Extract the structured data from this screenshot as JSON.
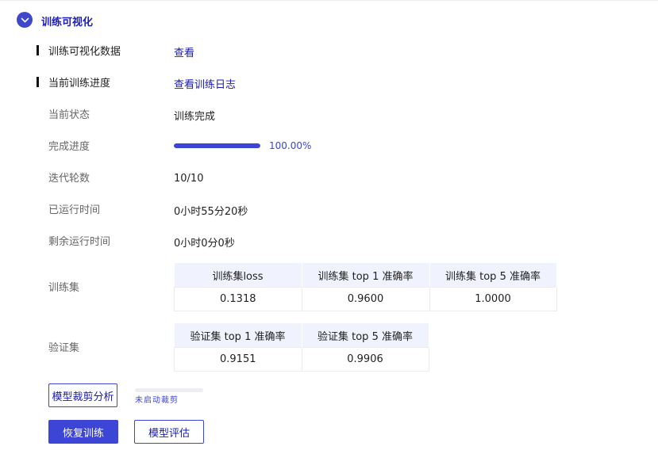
{
  "section": {
    "title": "训练可视化"
  },
  "rows": {
    "viz_data": {
      "label": "训练可视化数据",
      "link": "查看"
    },
    "progress_log": {
      "label": "当前训练进度",
      "link": "查看训练日志"
    },
    "status": {
      "label": "当前状态",
      "value": "训练完成"
    },
    "completion": {
      "label": "完成进度",
      "value_text": "100.00%",
      "fraction": 1.0
    },
    "epochs": {
      "label": "迭代轮数",
      "value": "10/10"
    },
    "elapsed": {
      "label": "已运行时间",
      "value": "0小时55分20秒"
    },
    "remaining": {
      "label": "剩余运行时间",
      "value": "0小时0分0秒"
    }
  },
  "train_set": {
    "label": "训练集",
    "headers": [
      "训练集loss",
      "训练集 top 1 准确率",
      "训练集 top 5 准确率"
    ],
    "values": [
      "0.1318",
      "0.9600",
      "1.0000"
    ]
  },
  "val_set": {
    "label": "验证集",
    "headers": [
      "验证集 top 1 准确率",
      "验证集 top 5 准确率"
    ],
    "values": [
      "0.9151",
      "0.9906"
    ]
  },
  "prune": {
    "button": "模型裁剪分析",
    "status": "未启动裁剪",
    "fraction": 0
  },
  "actions": {
    "resume": "恢复训练",
    "evaluate": "模型评估"
  },
  "colors": {
    "accent": "#3c45d6",
    "link": "#1a1ab0"
  },
  "icons": {
    "toggle": "chevron-down-icon"
  }
}
